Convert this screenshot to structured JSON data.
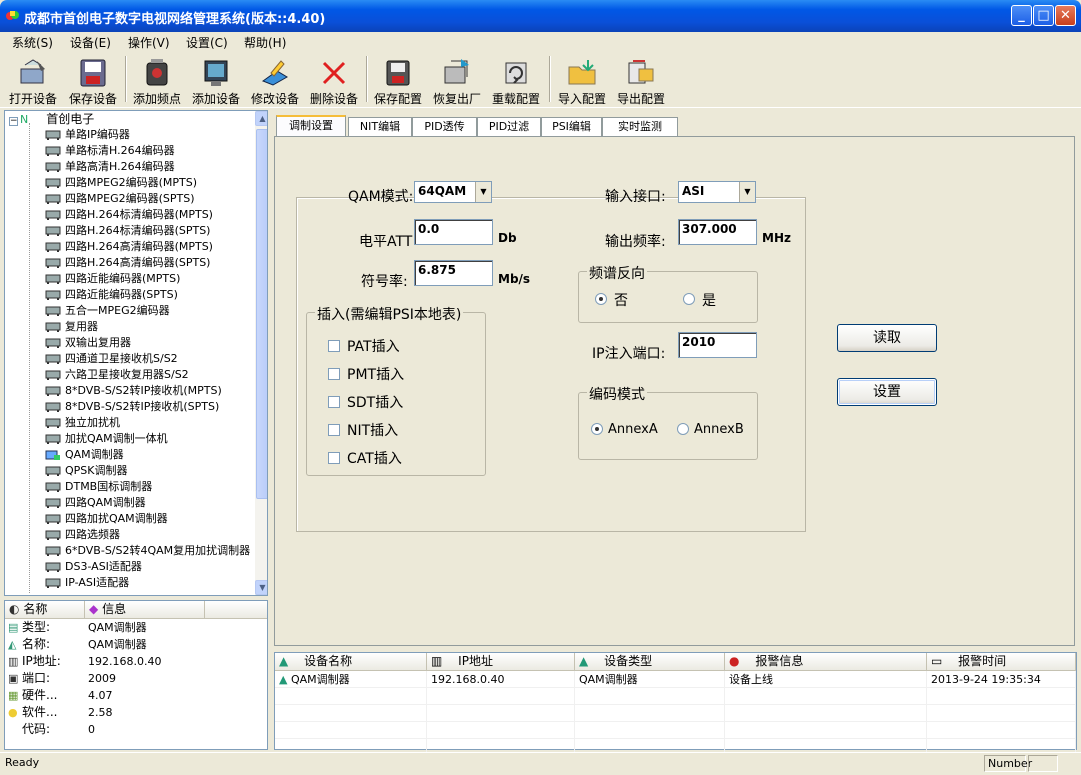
{
  "window": {
    "title": "成都市首创电子数字电视网络管理系统(版本::4.40)"
  },
  "menu": [
    "系统(S)",
    "设备(E)",
    "操作(V)",
    "设置(C)",
    "帮助(H)"
  ],
  "toolbar": [
    "打开设备",
    "保存设备",
    "添加频点",
    "添加设备",
    "修改设备",
    "删除设备",
    "保存配置",
    "恢复出厂",
    "重载配置",
    "导入配置",
    "导出配置"
  ],
  "tree": {
    "root": "首创电子",
    "items": [
      "单路IP编码器",
      "单路标清H.264编码器",
      "单路高清H.264编码器",
      "四路MPEG2编码器(MPTS)",
      "四路MPEG2编码器(SPTS)",
      "四路H.264标清编码器(MPTS)",
      "四路H.264标清编码器(SPTS)",
      "四路H.264高清编码器(MPTS)",
      "四路H.264高清编码器(SPTS)",
      "四路近能编码器(MPTS)",
      "四路近能编码器(SPTS)",
      "五合一MPEG2编码器",
      "复用器",
      "双输出复用器",
      "四通道卫星接收机S/S2",
      "六路卫星接收复用器S/S2",
      "8*DVB-S/S2转IP接收机(MPTS)",
      "8*DVB-S/S2转IP接收机(SPTS)",
      "独立加扰机",
      "加扰QAM调制一体机",
      "QAM调制器",
      "QPSK调制器",
      "DTMB国标调制器",
      "四路QAM调制器",
      "四路加扰QAM调制器",
      "四路选频器",
      "6*DVB-S/S2转4QAM复用加扰调制器",
      "DS3-ASI适配器",
      "IP-ASI适配器"
    ]
  },
  "info": {
    "headers": [
      "名称",
      "信息"
    ],
    "rows": [
      {
        "label": "类型:",
        "value": "QAM调制器"
      },
      {
        "label": "名称:",
        "value": "QAM调制器"
      },
      {
        "label": "IP地址:",
        "value": "192.168.0.40"
      },
      {
        "label": "端口:",
        "value": "2009"
      },
      {
        "label": "硬件...",
        "value": "4.07"
      },
      {
        "label": "软件...",
        "value": "2.58"
      },
      {
        "label": "代码:",
        "value": "0"
      }
    ]
  },
  "tabs": [
    "调制设置",
    "NIT编辑",
    "PID透传",
    "PID过滤",
    "PSI编辑",
    "实时监测"
  ],
  "form": {
    "qam_mode_label": "QAM模式:",
    "qam_mode_value": "64QAM",
    "input_iface_label": "输入接口:",
    "input_iface_value": "ASI",
    "level_label": "电平ATT",
    "level_value": "0.0",
    "level_unit": "Db",
    "out_freq_label": "输出频率:",
    "out_freq_value": "307.000",
    "out_freq_unit": "MHz",
    "symbol_label": "符号率:",
    "symbol_value": "6.875",
    "symbol_unit": "Mb/s",
    "spectrum_title": "频谱反向",
    "spectrum_no": "否",
    "spectrum_yes": "是",
    "insert_title": "插入(需编辑PSI本地表)",
    "inserts": [
      "PAT插入",
      "PMT插入",
      "SDT插入",
      "NIT插入",
      "CAT插入"
    ],
    "ip_port_label": "IP注入端口:",
    "ip_port_value": "2010",
    "encode_title": "编码模式",
    "annex_a": "AnnexA",
    "annex_b": "AnnexB",
    "read_button": "读取",
    "set_button": "设置"
  },
  "alarms": {
    "headers": [
      "设备名称",
      "IP地址",
      "设备类型",
      "报警信息",
      "报警时间"
    ],
    "rows": [
      {
        "name": "QAM调制器",
        "ip": "192.168.0.40",
        "type": "QAM调制器",
        "msg": "设备上线",
        "time": "2013-9-24 19:35:34"
      }
    ]
  },
  "status": {
    "text": "Ready",
    "number": "Number"
  }
}
